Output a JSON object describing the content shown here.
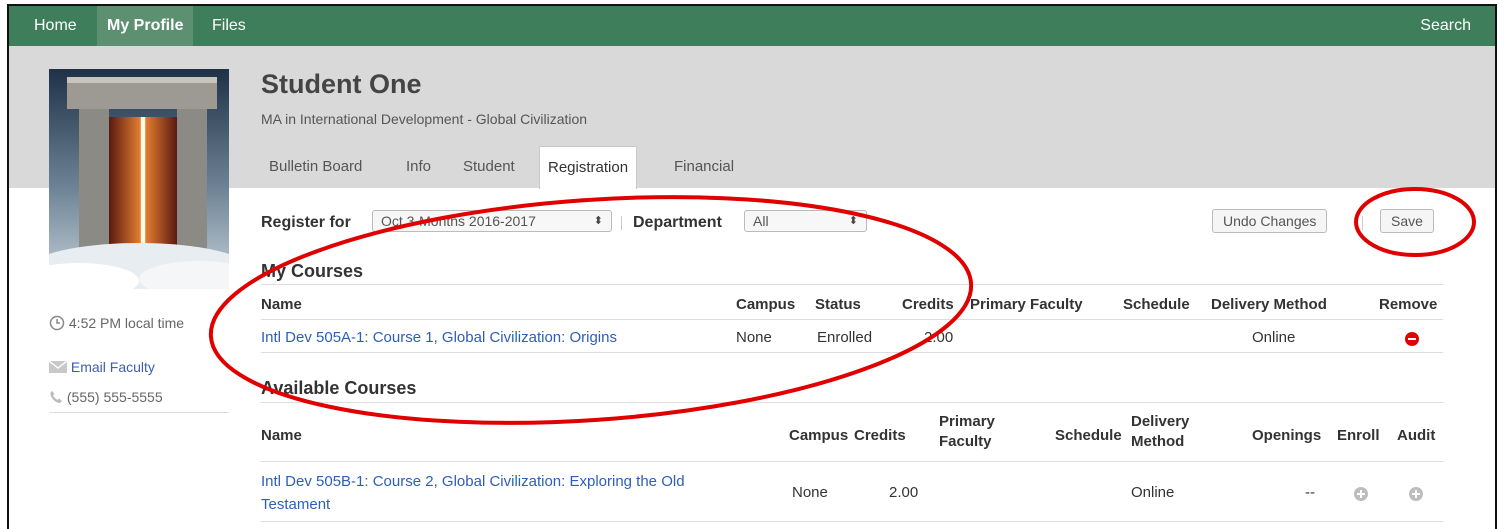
{
  "nav": {
    "home": "Home",
    "my_profile": "My Profile",
    "files": "Files",
    "search": "Search"
  },
  "profile": {
    "name": "Student One",
    "program": "MA in International Development - Global Civilization",
    "local_time": "4:52 PM local time",
    "email_link": "Email Faculty",
    "phone": "(555) 555-5555"
  },
  "tabs": [
    "Bulletin Board",
    "Info",
    "Student",
    "Registration",
    "Financial"
  ],
  "active_tab": "Registration",
  "controls": {
    "register_for_label": "Register for",
    "register_for_value": "Oct 3-Months 2016-2017",
    "department_label": "Department",
    "department_value": "All",
    "undo_label": "Undo Changes",
    "save_label": "Save"
  },
  "my_courses": {
    "title": "My Courses",
    "headers": {
      "name": "Name",
      "campus": "Campus",
      "status": "Status",
      "credits": "Credits",
      "primary_faculty": "Primary Faculty",
      "schedule": "Schedule",
      "delivery_method": "Delivery Method",
      "remove": "Remove"
    },
    "rows": [
      {
        "name": "Intl Dev 505A-1: Course 1, Global Civilization: Origins",
        "campus": "None",
        "status": "Enrolled",
        "credits": "2.00",
        "primary_faculty": "",
        "schedule": "",
        "delivery_method": "Online"
      }
    ]
  },
  "available_courses": {
    "title": "Available Courses",
    "headers": {
      "name": "Name",
      "campus": "Campus",
      "credits": "Credits",
      "primary_faculty_1": "Primary",
      "primary_faculty_2": "Faculty",
      "schedule": "Schedule",
      "delivery_method_1": "Delivery",
      "delivery_method_2": "Method",
      "openings": "Openings",
      "enroll": "Enroll",
      "audit": "Audit"
    },
    "rows": [
      {
        "name_line1": "Intl Dev 505B-1: Course 2, Global Civilization: Exploring the Old",
        "name_line2": "Testament",
        "campus": "None",
        "credits": "2.00",
        "primary_faculty": "",
        "schedule": "",
        "delivery_method": "Online",
        "openings": "--"
      }
    ]
  },
  "colors": {
    "nav_bg": "#3e7e5a",
    "nav_active": "#5d9070",
    "header_band": "#d9d9d9",
    "link": "#2d5fb8",
    "remove": "#e30000",
    "annotation": "#e00000"
  }
}
